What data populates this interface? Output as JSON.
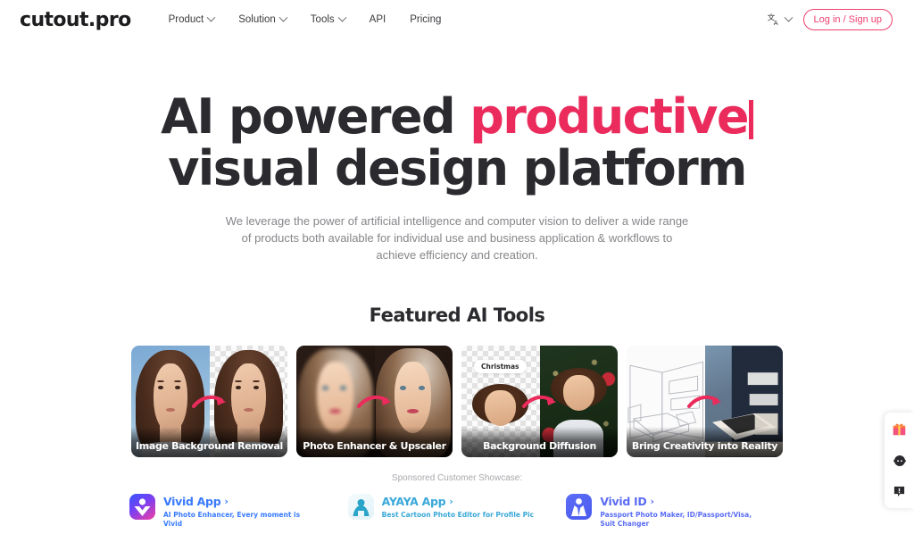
{
  "header": {
    "logo": "cutout.pro",
    "nav": [
      {
        "label": "Product",
        "has_caret": true
      },
      {
        "label": "Solution",
        "has_caret": true
      },
      {
        "label": "Tools",
        "has_caret": true
      },
      {
        "label": "API",
        "has_caret": false
      },
      {
        "label": "Pricing",
        "has_caret": false
      }
    ],
    "language_icon": "translate-icon",
    "login_label": "Log in / Sign up",
    "accent_color": "#ef4070"
  },
  "hero": {
    "title_prefix": "AI powered ",
    "title_accent": "productive",
    "title_line2": "visual design platform",
    "accent_color": "#ea2b5c",
    "subtitle": "We leverage the power of artificial intelligence and computer vision to deliver a wide range of products both available for individual use and business application & workflows to achieve efficiency and creation."
  },
  "featured": {
    "title": "Featured AI Tools",
    "cards": [
      {
        "label": "Image Background Removal"
      },
      {
        "label": "Photo Enhancer & Upscaler"
      },
      {
        "label": "Background Diffusion",
        "prompt_chip": "Christmas",
        "plus": "+"
      },
      {
        "label": "Bring Creativity into Reality"
      }
    ]
  },
  "sponsored": {
    "title": "Sponsored Customer Showcase:",
    "items": [
      {
        "name": "Vivid App",
        "chevron": "›",
        "desc": "AI Photo Enhancer, Every moment is Vivid",
        "logo": "vivid-app-logo",
        "color": "#3a7bfd"
      },
      {
        "name": "AYAYA App",
        "chevron": "›",
        "desc": "Best Cartoon Photo Editor for Profile Pic",
        "logo": "ayaya-app-logo",
        "color": "#3aa8d8"
      },
      {
        "name": "Vivid ID",
        "chevron": "›",
        "desc": "Passport Photo Maker, ID/Passport/Visa, Suit Changer",
        "logo": "vivid-id-logo",
        "color": "#5c6df5"
      }
    ]
  },
  "widget": {
    "buttons": [
      {
        "icon": "gift-icon"
      },
      {
        "icon": "customer-service-icon"
      },
      {
        "icon": "feedback-icon"
      }
    ]
  }
}
